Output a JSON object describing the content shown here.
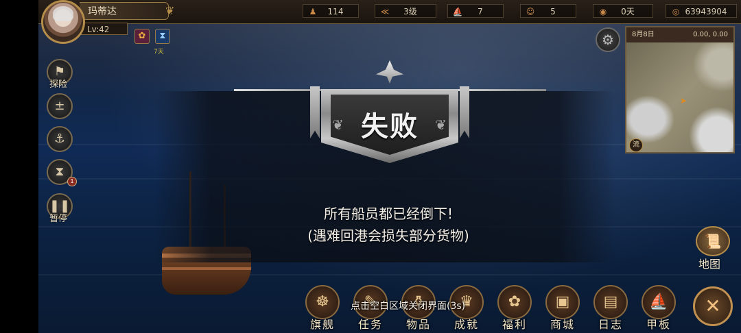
{
  "player": {
    "name": "玛蒂达",
    "level": "Lv:42"
  },
  "stats": [
    {
      "icon": "crew-icon",
      "glyph": "♟",
      "value": "114"
    },
    {
      "icon": "rank-icon",
      "glyph": "≪",
      "value": "3级"
    },
    {
      "icon": "ship-icon",
      "glyph": "⛵",
      "value": "7"
    },
    {
      "icon": "sailor-icon",
      "glyph": "☺",
      "value": "5"
    },
    {
      "icon": "food-icon",
      "glyph": "◉",
      "value": "0天"
    },
    {
      "icon": "gold-coin-icon",
      "glyph": "◎",
      "value": "63943904"
    }
  ],
  "buffs": {
    "label": "7天"
  },
  "side_buttons": [
    {
      "name": "explore",
      "glyph": "⚑",
      "label": "探险"
    },
    {
      "name": "compass",
      "glyph": "±",
      "label": ""
    },
    {
      "name": "anchor",
      "glyph": "⚓",
      "label": ""
    },
    {
      "name": "hourglass",
      "glyph": "⧗",
      "label": "",
      "badge": "1"
    },
    {
      "name": "pause",
      "glyph": "❚❚",
      "label": "暂停"
    }
  ],
  "minimap": {
    "date": "8月8日",
    "coords": "0.00, 0.00",
    "flow_label": "流"
  },
  "dialog": {
    "title": "失败",
    "message_line1": "所有船员都已经倒下!",
    "message_line2": "(遇难回港会损失部分货物)",
    "tap_hint": "点击空白区域关闭界面(3s)"
  },
  "map_button": {
    "label": "地图"
  },
  "bottom_menu": [
    {
      "name": "flagship",
      "glyph": "☸",
      "label": "旗舰"
    },
    {
      "name": "quests",
      "glyph": "✎",
      "label": "任务"
    },
    {
      "name": "items",
      "glyph": "⚱",
      "label": "物品"
    },
    {
      "name": "achievements",
      "glyph": "♛",
      "label": "成就"
    },
    {
      "name": "welfare",
      "glyph": "✿",
      "label": "福利"
    },
    {
      "name": "shop",
      "glyph": "▣",
      "label": "商城"
    },
    {
      "name": "journal",
      "glyph": "▤",
      "label": "日志"
    },
    {
      "name": "deck",
      "glyph": "⛵",
      "label": "甲板"
    }
  ],
  "colors": {
    "accent_gold": "#b58d4a",
    "fail_silver": "#d9d9d9",
    "ocean": "#0f2a55"
  }
}
